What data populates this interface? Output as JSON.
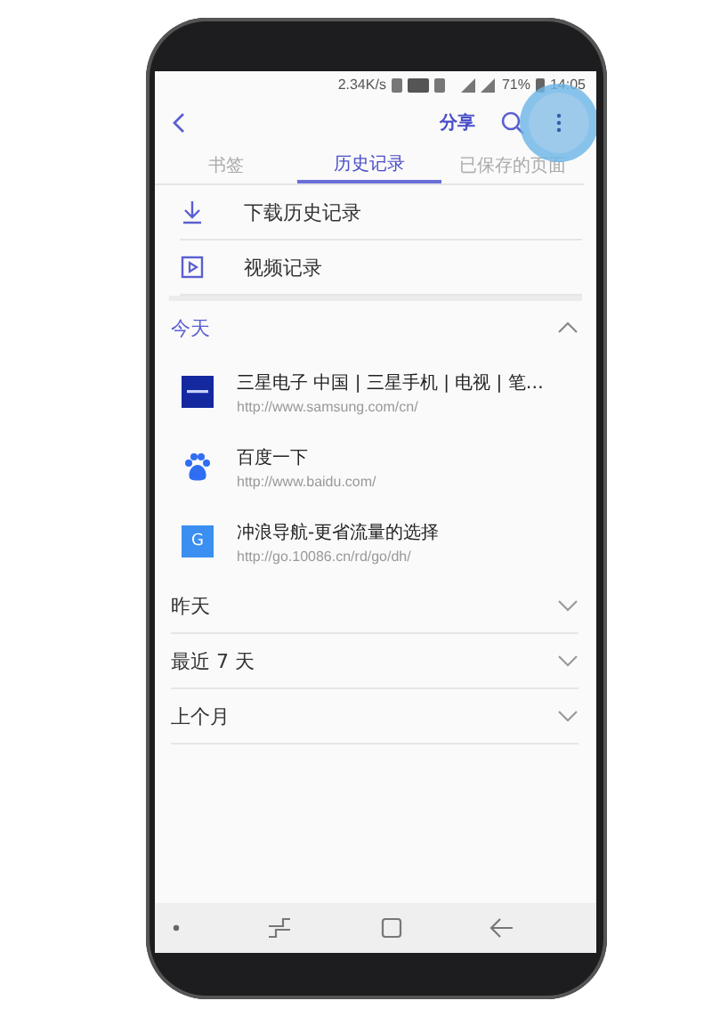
{
  "status_bar": {
    "speed": "2.34K/s",
    "battery": "71%",
    "time": "14:05"
  },
  "toolbar": {
    "share": "分享"
  },
  "tabs": [
    {
      "label": "书签",
      "selected": false
    },
    {
      "label": "历史记录",
      "selected": true
    },
    {
      "label": "已保存的页面",
      "selected": false
    }
  ],
  "quick_links": [
    {
      "label": "下载历史记录",
      "kind": "download"
    },
    {
      "label": "视频记录",
      "kind": "video"
    }
  ],
  "sections": [
    {
      "title": "今天",
      "expanded": true,
      "entries": [
        {
          "kind": "samsung",
          "title": "三星电子 中国 | 三星手机 | 电视 | 笔…",
          "url": "http://www.samsung.com/cn/"
        },
        {
          "kind": "baidu",
          "title": "百度一下",
          "url": "http://www.baidu.com/"
        },
        {
          "kind": "letter",
          "letter": "G",
          "title": "冲浪导航-更省流量的选择",
          "url": "http://go.10086.cn/rd/go/dh/"
        }
      ]
    },
    {
      "title": "昨天",
      "expanded": false
    },
    {
      "title": "最近 7 天",
      "expanded": false
    },
    {
      "title": "上个月",
      "expanded": false
    }
  ]
}
